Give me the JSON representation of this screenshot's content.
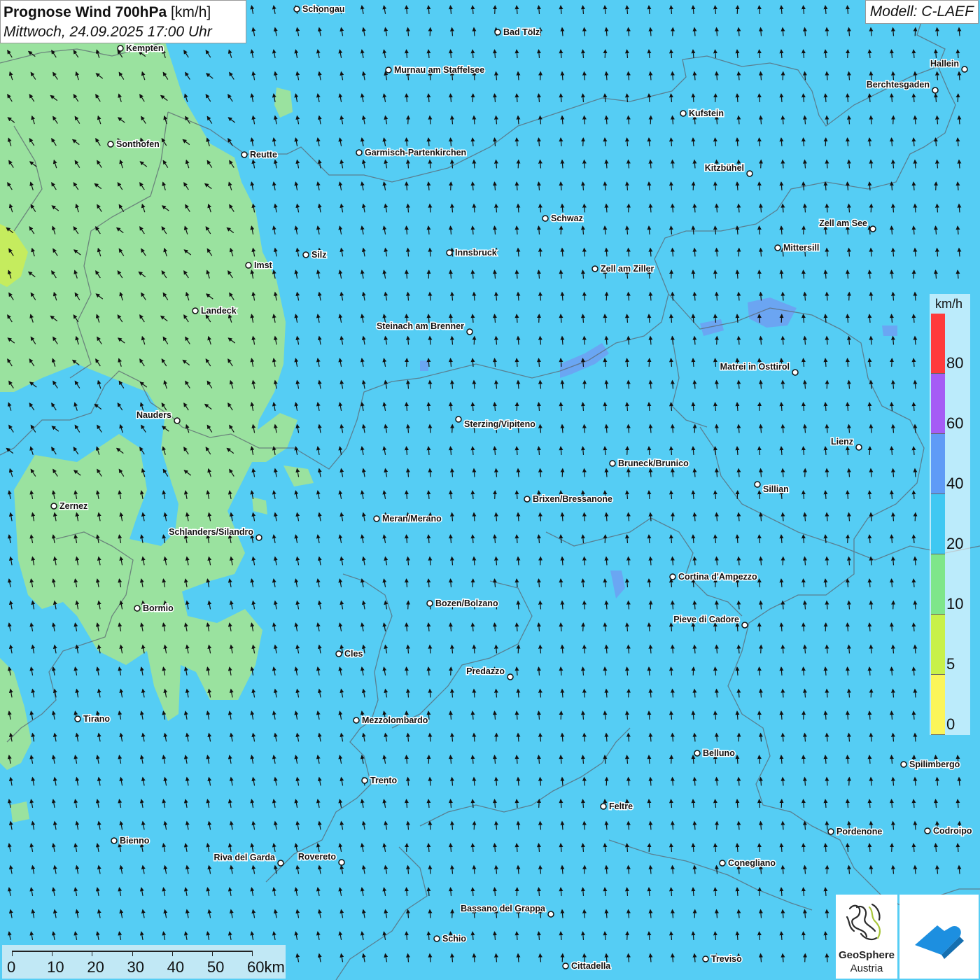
{
  "header": {
    "title_bold": "Prognose Wind 700hPa",
    "title_unit": "[km/h]",
    "subtitle": "Mittwoch, 24.09.2025 17:00 Uhr",
    "model": "Modell: C-LAEF"
  },
  "legend": {
    "unit": "km/h",
    "ticks": [
      "80",
      "60",
      "40",
      "20",
      "10",
      "5",
      "0"
    ],
    "colors": [
      "#ff3b3b",
      "#a55cf5",
      "#5f9bf6",
      "#3fc8f2",
      "#7ee68a",
      "#c8f14a",
      "#fbf55a"
    ]
  },
  "scale": {
    "labels": [
      "0",
      "10",
      "20",
      "30",
      "40",
      "50",
      "60km"
    ]
  },
  "logos": {
    "geosphere_line1": "GeoSphere",
    "geosphere_line2": "Austria",
    "geosphere_icon": "geosphere-logo-icon",
    "app_icon": "app-logo-icon"
  },
  "cities": [
    "Schongau",
    "Bad Tölz",
    "Kempten",
    "Murnau am Staffelsee",
    "Hallein",
    "Berchtesgaden",
    "Kufstein",
    "Sonthofen",
    "Reutte",
    "Garmisch-Partenkirchen",
    "Kitzbühel",
    "Schwaz",
    "Zell am See",
    "Mittersill",
    "Silz",
    "Innsbruck",
    "Imst",
    "Zell am Ziller",
    "Landeck",
    "Steinach am Brenner",
    "Matrei in Osttirol",
    "Nauders",
    "Sterzing/Vipiteno",
    "Lienz",
    "Bruneck/Brunico",
    "Sillian",
    "Zernez",
    "Brixen/Bressanone",
    "Meran/Merano",
    "Schlanders/Silandro",
    "Cortina d'Ampezzo",
    "Bozen/Bolzano",
    "Bormio",
    "Pieve di Cadore",
    "Cles",
    "Predazzo",
    "Tirano",
    "Mezzolombardo",
    "Belluno",
    "Spilimbergo",
    "Trento",
    "Feltre",
    "Pordenone",
    "Codroipo",
    "Bienno",
    "Riva del Garda",
    "Rovereto",
    "Conegliano",
    "Bassano del Grappa",
    "Schio",
    "Treviso",
    "Cittadella"
  ]
}
